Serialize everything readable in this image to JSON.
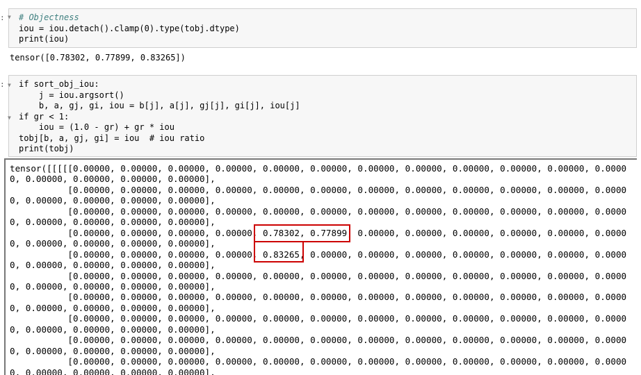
{
  "cell1": {
    "prompt": ":",
    "lines": [
      "# Objectness",
      "iou = iou.detach().clamp(0).type(tobj.dtype)",
      "print(iou)"
    ]
  },
  "output1": "tensor([0.78302, 0.77899, 0.83265])",
  "cell2": {
    "prompt": ":",
    "lines": [
      "if sort_obj_iou:",
      "    j = iou.argsort()",
      "    b, a, gj, gi, iou = b[j], a[j], gj[j], gi[j], iou[j]",
      "if gr < 1:",
      "    iou = (1.0 - gr) + gr * iou",
      "tobj[b, a, gj, gi] = iou  # iou ratio",
      "print(tobj)"
    ]
  },
  "output2": {
    "lines": [
      "tensor([[[[[0.00000, 0.00000, 0.00000, 0.00000, 0.00000, 0.00000, 0.00000, 0.00000, 0.00000, 0.00000, 0.00000, 0.0000",
      "0, 0.00000, 0.00000, 0.00000, 0.00000],",
      "           [0.00000, 0.00000, 0.00000, 0.00000, 0.00000, 0.00000, 0.00000, 0.00000, 0.00000, 0.00000, 0.00000, 0.0000",
      "0, 0.00000, 0.00000, 0.00000, 0.00000],",
      "           [0.00000, 0.00000, 0.00000, 0.00000, 0.00000, 0.00000, 0.00000, 0.00000, 0.00000, 0.00000, 0.00000, 0.0000",
      "0, 0.00000, 0.00000, 0.00000, 0.00000],",
      "           [0.00000, 0.00000, 0.00000, 0.00000, 0.78302, 0.77899, 0.00000, 0.00000, 0.00000, 0.00000, 0.00000, 0.0000",
      "0, 0.00000, 0.00000, 0.00000, 0.00000],",
      "           [0.00000, 0.00000, 0.00000, 0.00000, 0.83265, 0.00000, 0.00000, 0.00000, 0.00000, 0.00000, 0.00000, 0.0000",
      "0, 0.00000, 0.00000, 0.00000, 0.00000],",
      "           [0.00000, 0.00000, 0.00000, 0.00000, 0.00000, 0.00000, 0.00000, 0.00000, 0.00000, 0.00000, 0.00000, 0.0000",
      "0, 0.00000, 0.00000, 0.00000, 0.00000],",
      "           [0.00000, 0.00000, 0.00000, 0.00000, 0.00000, 0.00000, 0.00000, 0.00000, 0.00000, 0.00000, 0.00000, 0.0000",
      "0, 0.00000, 0.00000, 0.00000, 0.00000],",
      "           [0.00000, 0.00000, 0.00000, 0.00000, 0.00000, 0.00000, 0.00000, 0.00000, 0.00000, 0.00000, 0.00000, 0.0000",
      "0, 0.00000, 0.00000, 0.00000, 0.00000],",
      "           [0.00000, 0.00000, 0.00000, 0.00000, 0.00000, 0.00000, 0.00000, 0.00000, 0.00000, 0.00000, 0.00000, 0.0000",
      "0, 0.00000, 0.00000, 0.00000, 0.00000],",
      "           [0.00000, 0.00000, 0.00000, 0.00000, 0.00000, 0.00000, 0.00000, 0.00000, 0.00000, 0.00000, 0.00000, 0.0000",
      "0, 0.00000, 0.00000, 0.00000, 0.00000],"
    ]
  },
  "colors": {
    "highlight": "#cc0000",
    "keyword": "#008000",
    "comment": "#408080"
  }
}
